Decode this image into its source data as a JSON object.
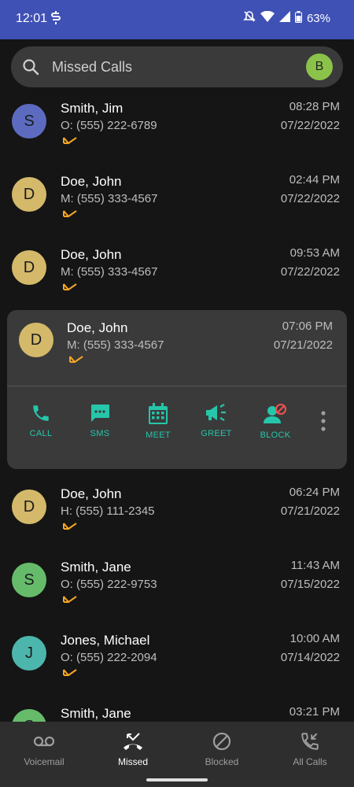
{
  "status": {
    "time": "12:01",
    "battery": "63%"
  },
  "search": {
    "placeholder": "Missed Calls",
    "profile_initial": "B"
  },
  "calls": [
    {
      "initial": "S",
      "name": "Smith, Jim",
      "number": "O: (555) 222-6789",
      "time": "08:28 PM",
      "date": "07/22/2022",
      "avatar_color": "#5c6bc0"
    },
    {
      "initial": "D",
      "name": "Doe, John",
      "number": "M: (555) 333-4567",
      "time": "02:44 PM",
      "date": "07/22/2022",
      "avatar_color": "#d4b96a"
    },
    {
      "initial": "D",
      "name": "Doe, John",
      "number": "M: (555) 333-4567",
      "time": "09:53 AM",
      "date": "07/22/2022",
      "avatar_color": "#d4b96a"
    },
    {
      "initial": "D",
      "name": "Doe, John",
      "number": "M: (555) 333-4567",
      "time": "07:06 PM",
      "date": "07/21/2022",
      "avatar_color": "#d4b96a"
    },
    {
      "initial": "D",
      "name": "Doe, John",
      "number": "H: (555) 111-2345",
      "time": "06:24 PM",
      "date": "07/21/2022",
      "avatar_color": "#d4b96a"
    },
    {
      "initial": "S",
      "name": "Smith, Jane",
      "number": "O: (555) 222-9753",
      "time": "11:43 AM",
      "date": "07/15/2022",
      "avatar_color": "#66bb6a"
    },
    {
      "initial": "J",
      "name": "Jones, Michael",
      "number": "O: (555) 222-2094",
      "time": "10:00 AM",
      "date": "07/14/2022",
      "avatar_color": "#4db6ac"
    },
    {
      "initial": "S",
      "name": "Smith, Jane",
      "number": "",
      "time": "03:21 PM",
      "date": "",
      "avatar_color": "#66bb6a"
    }
  ],
  "actions": {
    "call": "CALL",
    "sms": "SMS",
    "meet": "MEET",
    "greet": "GREET",
    "block": "BLOCK"
  },
  "nav": {
    "voicemail": "Voicemail",
    "missed": "Missed",
    "blocked": "Blocked",
    "all_calls": "All Calls"
  },
  "colors": {
    "accent": "#26c6aa",
    "missed_icon": "#f5a623",
    "status_bar": "#3f51b5"
  }
}
